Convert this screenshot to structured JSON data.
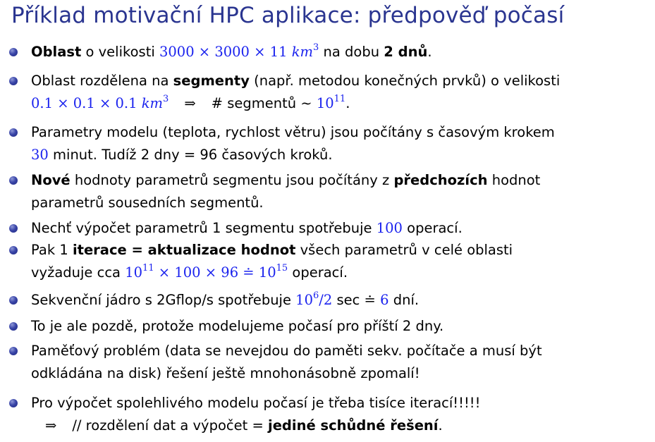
{
  "title": "Příklad motivační HPC aplikace: předpověď počasí",
  "items": [
    {
      "b": "Oblast",
      "t1": " o velikosti ",
      "m1": "3000 × 3000 × 11 ",
      "m1u": "km",
      "m1e": "3",
      "t2": " na dobu ",
      "b2": "2 dnů",
      "t3": "."
    },
    {
      "t1": "Oblast rozdělena na ",
      "b": "segmenty",
      "t2": " (např. metodou konečných prvků) o velikosti",
      "m1": "0.1 × 0.1 × 0.1 ",
      "m1u": "km",
      "m1e": "3",
      "arrow": "⇒",
      "hash": "#",
      "t3": " segmentů ",
      "sim": "∼",
      "m2": "10",
      "m2e": "11",
      "t4": "."
    },
    {
      "t1": "Parametry modelu (teplota, rychlost větru) jsou počítány s časovým krokem",
      "m1": "30",
      "t2": " minut. Tudíž 2 dny = 96 časových kroků."
    },
    {
      "b": "Nové",
      "t1": " hodnoty parametrů segmentu jsou počítány z ",
      "b2": "předchozích",
      "t2": " hodnot",
      "t3": "parametrů sousedních segmentů."
    },
    {
      "t1": "Nechť výpočet parametrů 1 segmentu spotřebuje ",
      "m1": "100",
      "t2": " operací."
    },
    {
      "t1": "Pak 1 ",
      "b": "iterace = aktualizace hodnot",
      "t2": " všech parametrů v celé oblasti",
      "t3": "vyžaduje cca ",
      "m1": "10",
      "m1e": "11",
      "m1b": " × 100 × 96 ≐ 10",
      "m1be": "15",
      "t4": " operací."
    },
    {
      "t1": "Sekvenční jádro s 2Gflop/s spotřebuje ",
      "m1": "10",
      "m1e": "6",
      "m1b": "/2",
      "t2": " sec ",
      "eq": "≐",
      "m2": "6",
      "t3": " dní."
    },
    {
      "t1": "To je ale pozdě, protože modelujeme počasí pro příští 2 dny."
    },
    {
      "t1": "Paměťový problém (data se nevejdou do paměti sekv. počítače a musí být",
      "t2": "odkládána na disk) řešení ještě mnohonásobně zpomalí!"
    },
    {
      "t1": "Pro výpočet spolehlivého modelu počasí je třeba tisíce iterací!!!!!",
      "arrow": "⇒",
      "t2": "// rozdělení dat a výpočet = ",
      "b": "jediné schůdné řešení",
      "t3": "."
    }
  ]
}
